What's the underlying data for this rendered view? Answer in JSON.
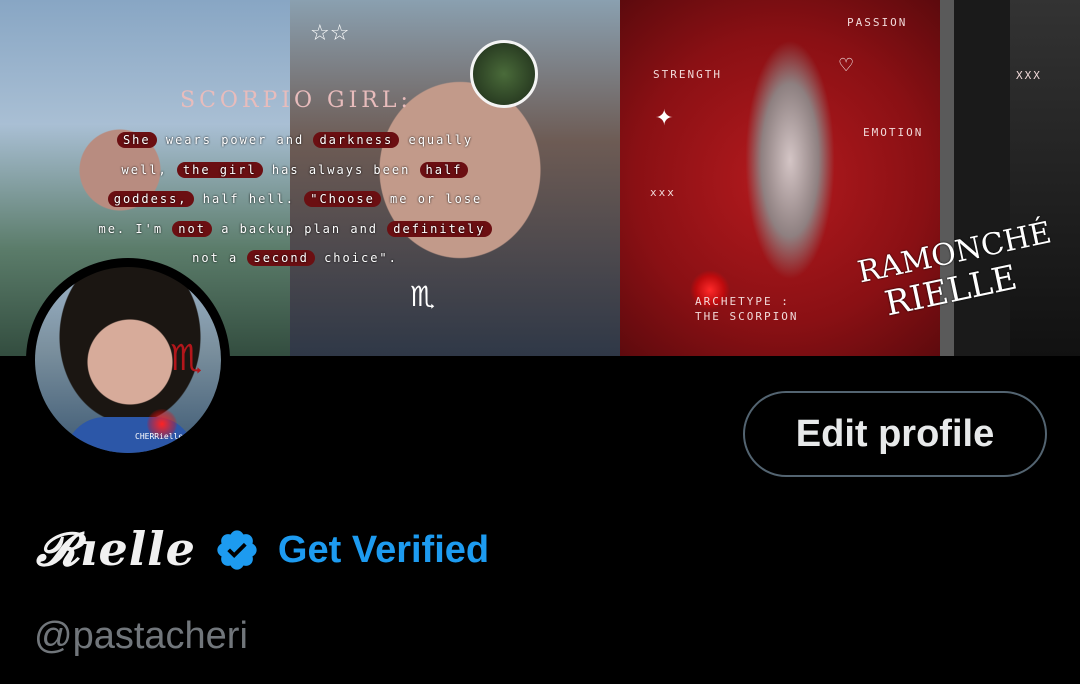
{
  "banner": {
    "poem_lines": [
      [
        {
          "t": "She",
          "h": true
        },
        {
          "t": " wears power and ",
          "h": false
        },
        {
          "t": "darkness",
          "h": true
        },
        {
          "t": " equally",
          "h": false
        }
      ],
      [
        {
          "t": "well, ",
          "h": false
        },
        {
          "t": "the girl",
          "h": true
        },
        {
          "t": " has always been ",
          "h": false
        },
        {
          "t": "half",
          "h": true
        }
      ],
      [
        {
          "t": "goddess,",
          "h": true
        },
        {
          "t": " half hell. ",
          "h": false
        },
        {
          "t": "\"Choose",
          "h": true
        },
        {
          "t": " me or lose",
          "h": false
        }
      ],
      [
        {
          "t": "me. I'm ",
          "h": false
        },
        {
          "t": "not",
          "h": true
        },
        {
          "t": " a backup plan and ",
          "h": false
        },
        {
          "t": "definitely",
          "h": true
        }
      ],
      [
        {
          "t": "not a ",
          "h": false
        },
        {
          "t": "second",
          "h": true
        },
        {
          "t": " choice\".",
          "h": false
        }
      ]
    ],
    "scorpio_title": "SCORPIO GIRL:",
    "strength": "STRENGTH",
    "passion": "PASSION",
    "emotion": "EMOTION",
    "xxx_left": "xxx",
    "xxx_right": "XXX",
    "archetype_line1": "ARCHETYPE :",
    "archetype_line2": "THE SCORPION",
    "signature_line1": "RAMONCHÉ",
    "signature_line2": "RIELLE",
    "zodiac_glyph": "♏"
  },
  "avatar": {
    "caption": "CHERRielle"
  },
  "profile": {
    "display_name": "𝓡ıelle",
    "get_verified": "Get Verified",
    "handle": "@pastacheri",
    "edit_profile": "Edit profile",
    "verified_color": "#1d9bf0"
  }
}
